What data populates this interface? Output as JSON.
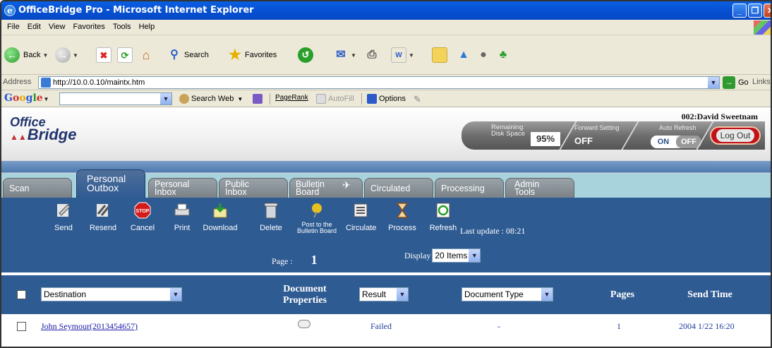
{
  "window": {
    "title": "OfficeBridge Pro - Microsoft Internet Explorer",
    "icon": "ie-icon"
  },
  "menu": [
    "File",
    "Edit",
    "View",
    "Favorites",
    "Tools",
    "Help"
  ],
  "toolbar": {
    "back": "Back",
    "search": "Search",
    "favorites": "Favorites"
  },
  "address": {
    "label": "Address",
    "url": "http://10.0.0.10/maintx.htm",
    "go": "Go",
    "links": "Links"
  },
  "google": {
    "logo": "Google",
    "search_web": "Search Web",
    "pagerank": "PageRank",
    "autofill": "AutoFill",
    "options": "Options"
  },
  "app": {
    "logo_line1": "Office",
    "logo_line2": "Bridge",
    "user": "002:David Sweetnam",
    "remaining_label_1": "Remaining",
    "remaining_label_2": "Disk Space",
    "disk_value": "95%",
    "forward_label": "Forward Setting",
    "forward_value": "OFF",
    "auto_refresh_label": "Auto Refresh",
    "auto_refresh_on": "ON",
    "auto_refresh_off": "OFF",
    "logout": "Log Out"
  },
  "tabs": [
    {
      "line1": "Scan",
      "line2": ""
    },
    {
      "line1": "Personal",
      "line2": "Outbox"
    },
    {
      "line1": "Personal",
      "line2": "Inbox"
    },
    {
      "line1": "Public",
      "line2": "Inbox"
    },
    {
      "line1": "Bulletin",
      "line2": "Board"
    },
    {
      "line1": "Circulated",
      "line2": ""
    },
    {
      "line1": "Processing",
      "line2": ""
    },
    {
      "line1": "Admin",
      "line2": "Tools"
    }
  ],
  "actions": {
    "send": "Send",
    "resend": "Resend",
    "cancel": "Cancel",
    "print": "Print",
    "download": "Download",
    "delete": "Delete",
    "post_1": "Post to the",
    "post_2": "Bulletin Board",
    "circulate": "Circulate",
    "process": "Process",
    "refresh": "Refresh",
    "last_update": "Last update : 08:21",
    "stop_icon_text": "STOP"
  },
  "paging": {
    "page_label": "Page :",
    "page_value": "1",
    "display_label": "Display",
    "display_value": "20 Items"
  },
  "table": {
    "headers": {
      "destination": "Destination",
      "doc_props_1": "Document",
      "doc_props_2": "Properties",
      "result": "Result",
      "doc_type": "Document Type",
      "pages": "Pages",
      "send_time": "Send Time"
    },
    "rows": [
      {
        "destination": "John Seymour(2013454657)",
        "result": "Failed",
        "doc_type": "-",
        "pages": "1",
        "send_time": "2004 1/22 16:20"
      }
    ]
  },
  "colors": {
    "app_blue": "#2f5b93",
    "tab_grey": "#8a9298",
    "logout_red": "#c1121a"
  }
}
